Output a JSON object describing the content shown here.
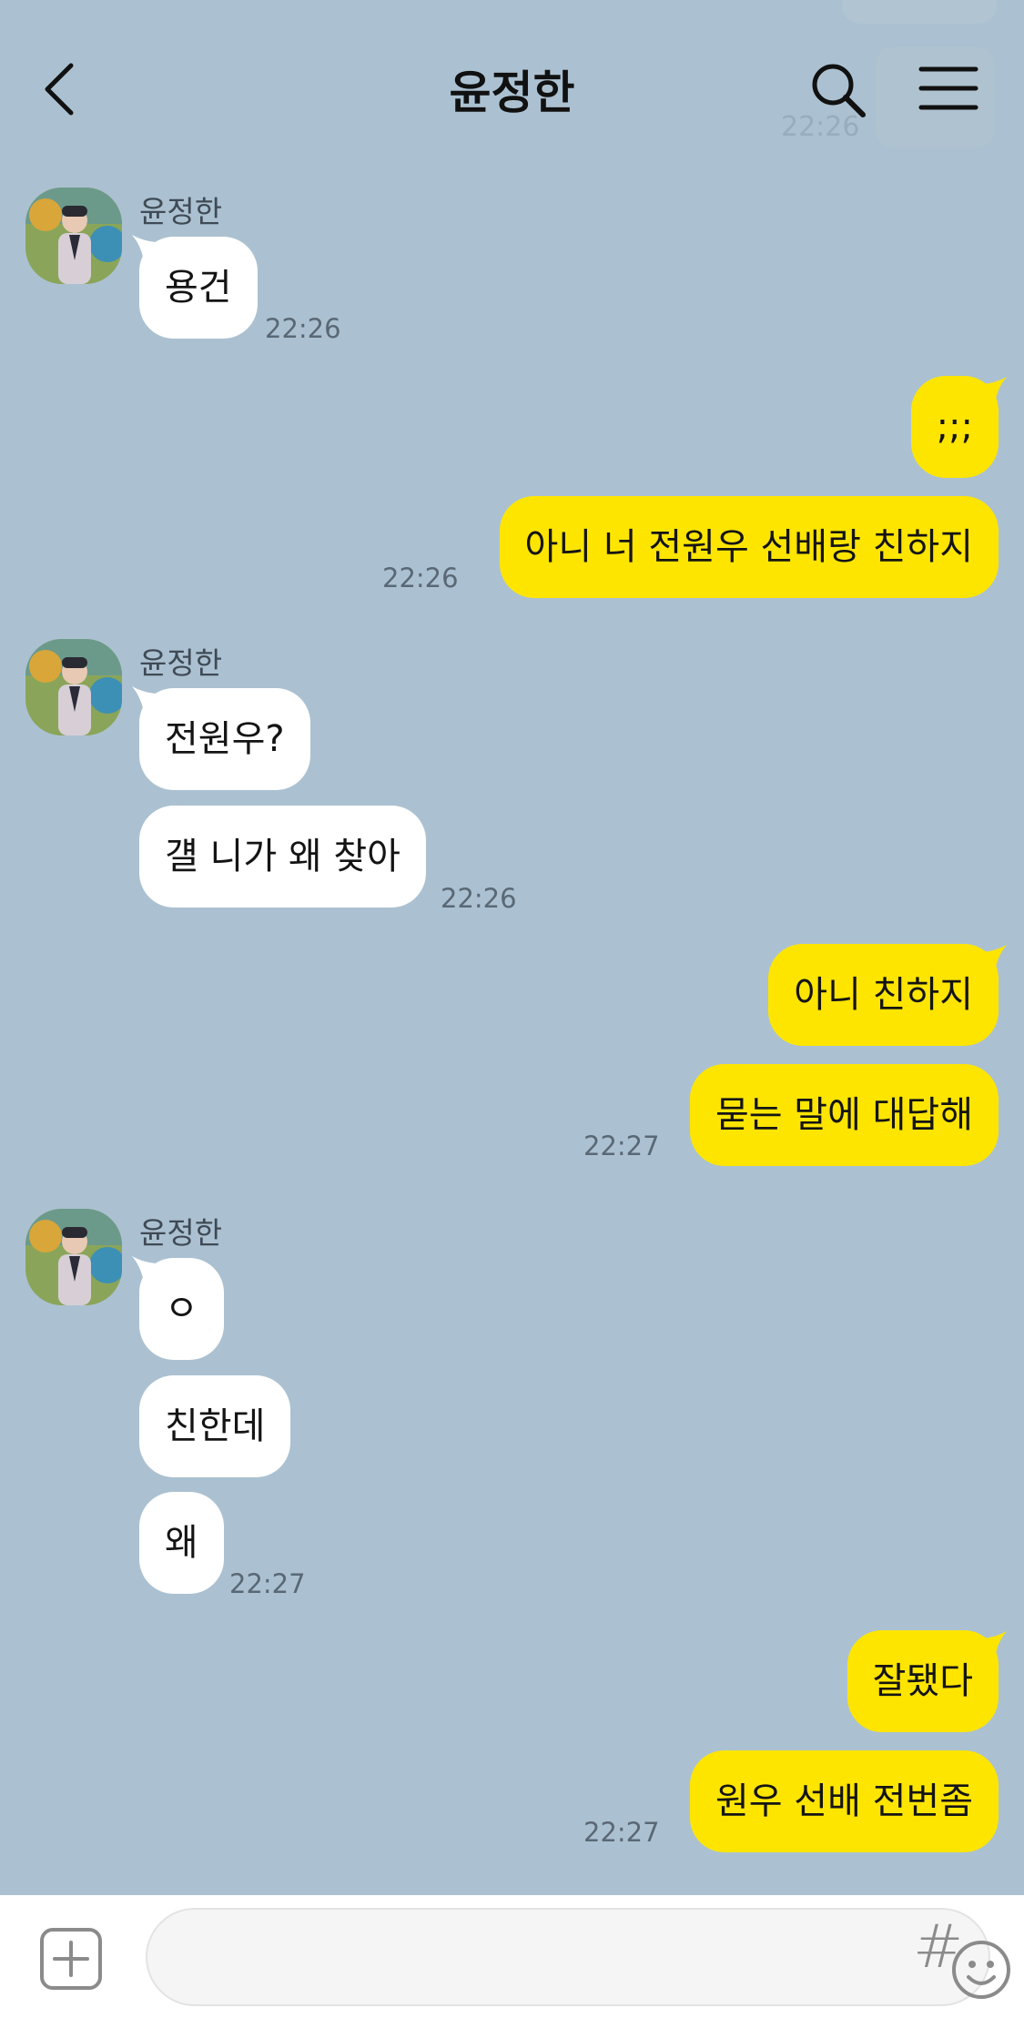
{
  "header": {
    "title": "윤정한",
    "ghost_time": "22:26"
  },
  "contact": {
    "name": "윤정한"
  },
  "groups": [
    {
      "sender_name": "윤정한",
      "messages": [
        "용건"
      ],
      "time": "22:26"
    },
    {
      "messages": [
        ";;;",
        "아니 너 전원우 선배랑 친하지"
      ],
      "time": "22:26"
    },
    {
      "sender_name": "윤정한",
      "messages": [
        "전원우?",
        "걜 니가 왜 찾아"
      ],
      "time": "22:26"
    },
    {
      "messages": [
        "아니 친하지",
        "묻는 말에 대답해"
      ],
      "time": "22:27"
    },
    {
      "sender_name": "윤정한",
      "messages": [
        "ㅇ",
        "친한데",
        "왜"
      ],
      "time": "22:27"
    },
    {
      "messages": [
        "잘됐다",
        "원우 선배 전번좀"
      ],
      "time": "22:27"
    }
  ],
  "input": {
    "value": "",
    "placeholder": ""
  },
  "bottom": {
    "hash_label": "#"
  },
  "colors": {
    "background": "#abc1d1",
    "outgoing_bubble": "#fee500",
    "incoming_bubble": "#ffffff"
  },
  "icons": [
    "back-arrow-icon",
    "search-icon",
    "hamburger-menu-icon",
    "plus-icon",
    "emoji-icon",
    "hash-icon"
  ]
}
